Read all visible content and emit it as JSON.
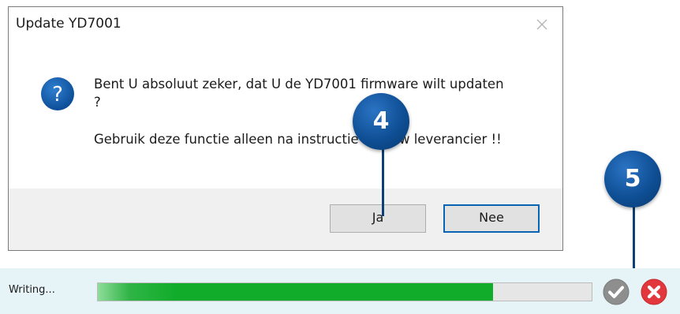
{
  "dialog": {
    "title": "Update YD7001",
    "close_icon": "close-icon",
    "question_icon": "question-icon",
    "message_line_1": "Bent U absoluut zeker, dat U de YD7001 firmware wilt updaten ?",
    "message_line_2": "Gebruik deze functie alleen na instructie van uw leverancier !!",
    "buttons": {
      "yes_label": "Ja",
      "no_label": "Nee"
    }
  },
  "callouts": [
    {
      "number": "4"
    },
    {
      "number": "5"
    }
  ],
  "progress": {
    "status_label": "Writing...",
    "fraction": 0.8,
    "check_icon": "check-icon",
    "cancel_icon": "cancel-icon"
  },
  "colors": {
    "callout_blue": "#0f4f95",
    "progress_green": "#10ac2a",
    "cancel_red": "#e2373c",
    "default_button_border": "#0a64b4"
  }
}
